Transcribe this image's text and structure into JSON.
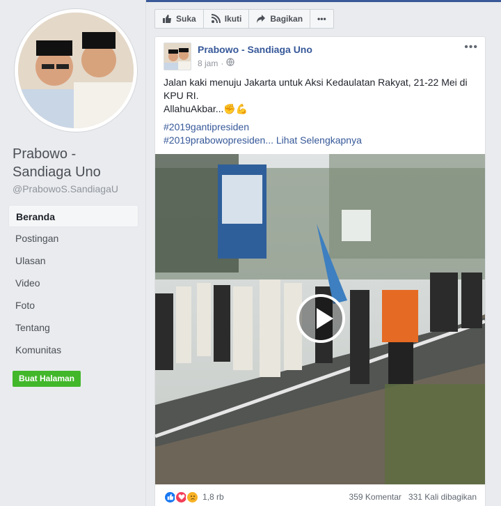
{
  "sidebar": {
    "page_name": "Prabowo - Sandiaga Uno",
    "handle": "@PrabowoS.SandiagaU",
    "nav": [
      {
        "label": "Beranda"
      },
      {
        "label": "Postingan"
      },
      {
        "label": "Ulasan"
      },
      {
        "label": "Video"
      },
      {
        "label": "Foto"
      },
      {
        "label": "Tentang"
      },
      {
        "label": "Komunitas"
      }
    ],
    "create_page": "Buat Halaman"
  },
  "actions": {
    "like": "Suka",
    "follow": "Ikuti",
    "share": "Bagikan",
    "more": "•••"
  },
  "post": {
    "author": "Prabowo - Sandiaga Uno",
    "time": "8 jam",
    "visibility_icon": "globe-icon",
    "text_line1": "Jalan kaki menuju Jakarta untuk Aksi Kedaulatan Rakyat, 21-22 Mei di KPU RI.",
    "text_line2": "AllahuAkbar...✊💪",
    "hashtag1": "#2019gantipresiden",
    "hashtag2": "#2019prabowopresiden... Lihat Selengkapnya",
    "more": "•••",
    "reaction_count": "1,8 rb",
    "comments": "359 Komentar",
    "shares": "331 Kali dibagikan"
  },
  "colors": {
    "brand_blue": "#365899",
    "green": "#42b72a"
  }
}
